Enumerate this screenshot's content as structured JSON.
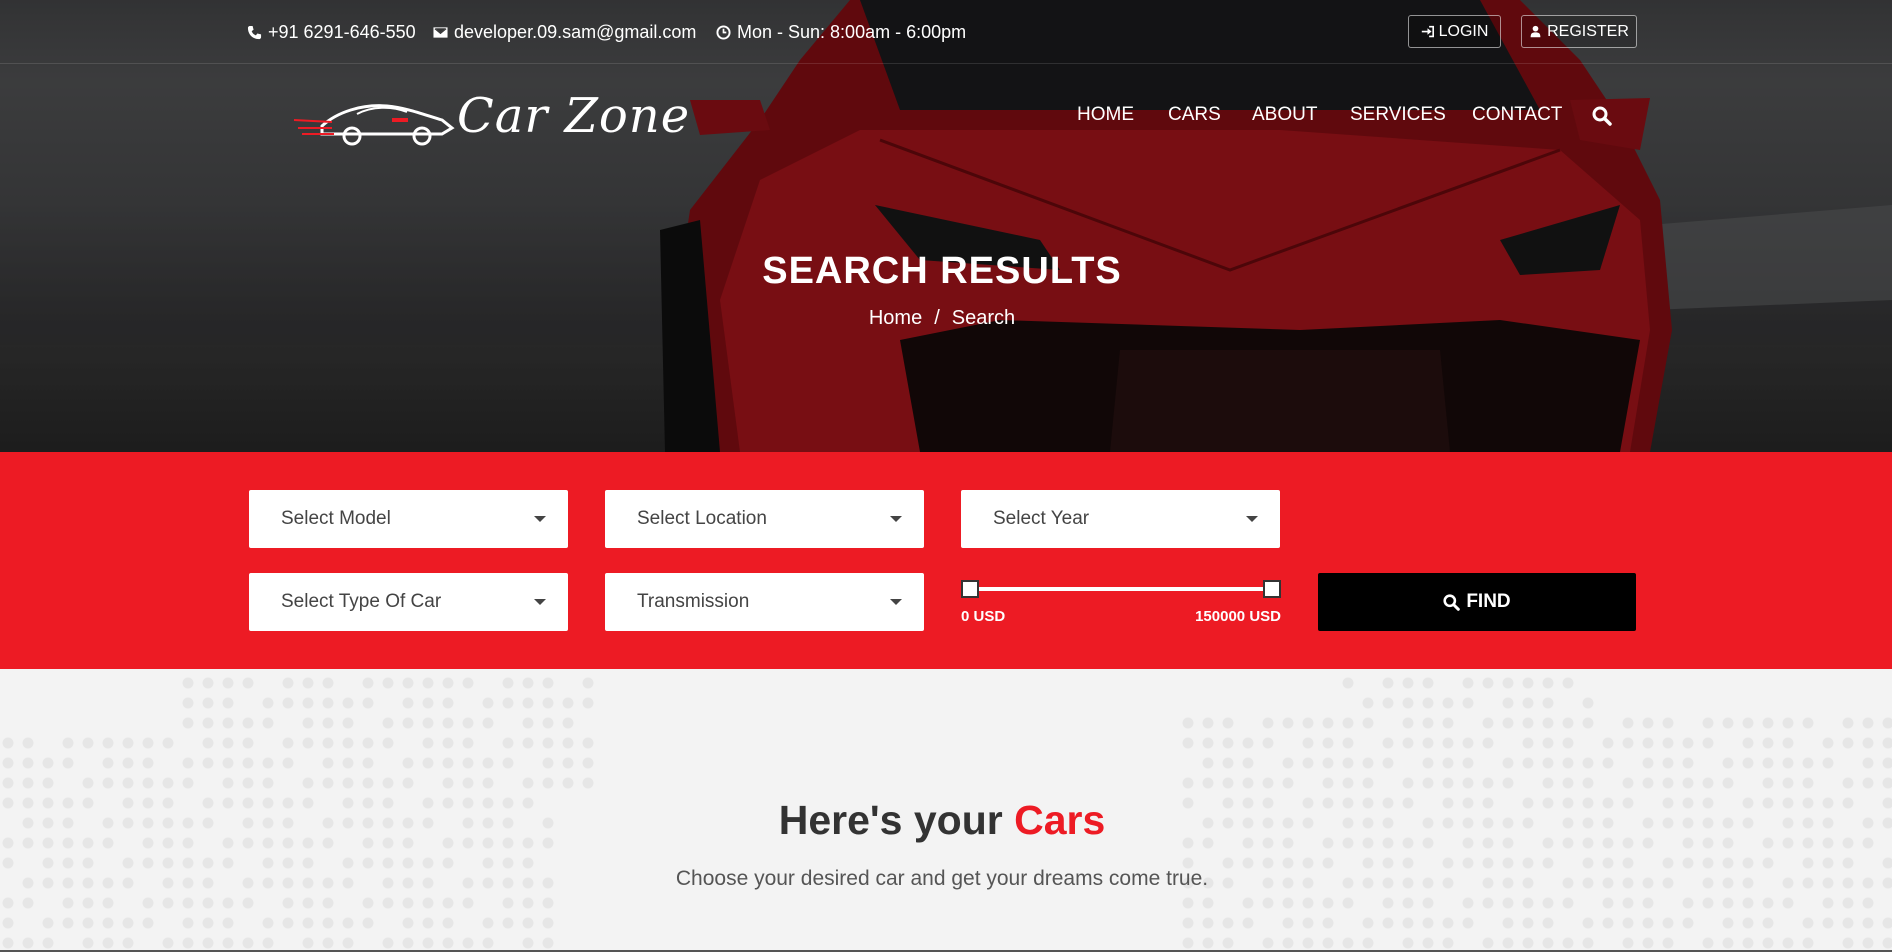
{
  "topbar": {
    "phone": "+91 6291-646-550",
    "email": "developer.09.sam@gmail.com",
    "hours": "Mon - Sun: 8:00am - 6:00pm",
    "login_label": "LOGIN",
    "register_label": "REGISTER"
  },
  "brand": {
    "name": "Car Zone"
  },
  "nav": {
    "items": [
      {
        "label": "HOME"
      },
      {
        "label": "CARS"
      },
      {
        "label": "ABOUT"
      },
      {
        "label": "SERVICES"
      },
      {
        "label": "CONTACT"
      }
    ],
    "search_icon": "search-icon"
  },
  "hero": {
    "title": "SEARCH RESULTS",
    "breadcrumb": {
      "home": "Home",
      "separator": "/",
      "current": "Search"
    }
  },
  "search": {
    "model": "Select Model",
    "location": "Select Location",
    "year": "Select Year",
    "type": "Select Type Of Car",
    "transmission": "Transmission",
    "price_min_label": "0 USD",
    "price_max_label": "150000 USD",
    "price_min": 0,
    "price_max": 150000,
    "find_label": "FIND"
  },
  "section": {
    "title_prefix": "Here's your ",
    "title_accent": "Cars",
    "subtitle": "Choose your desired car and get your dreams come true."
  },
  "colors": {
    "accent": "#ed1b24",
    "find_button": "#000000",
    "background": "#f3f3f3"
  }
}
